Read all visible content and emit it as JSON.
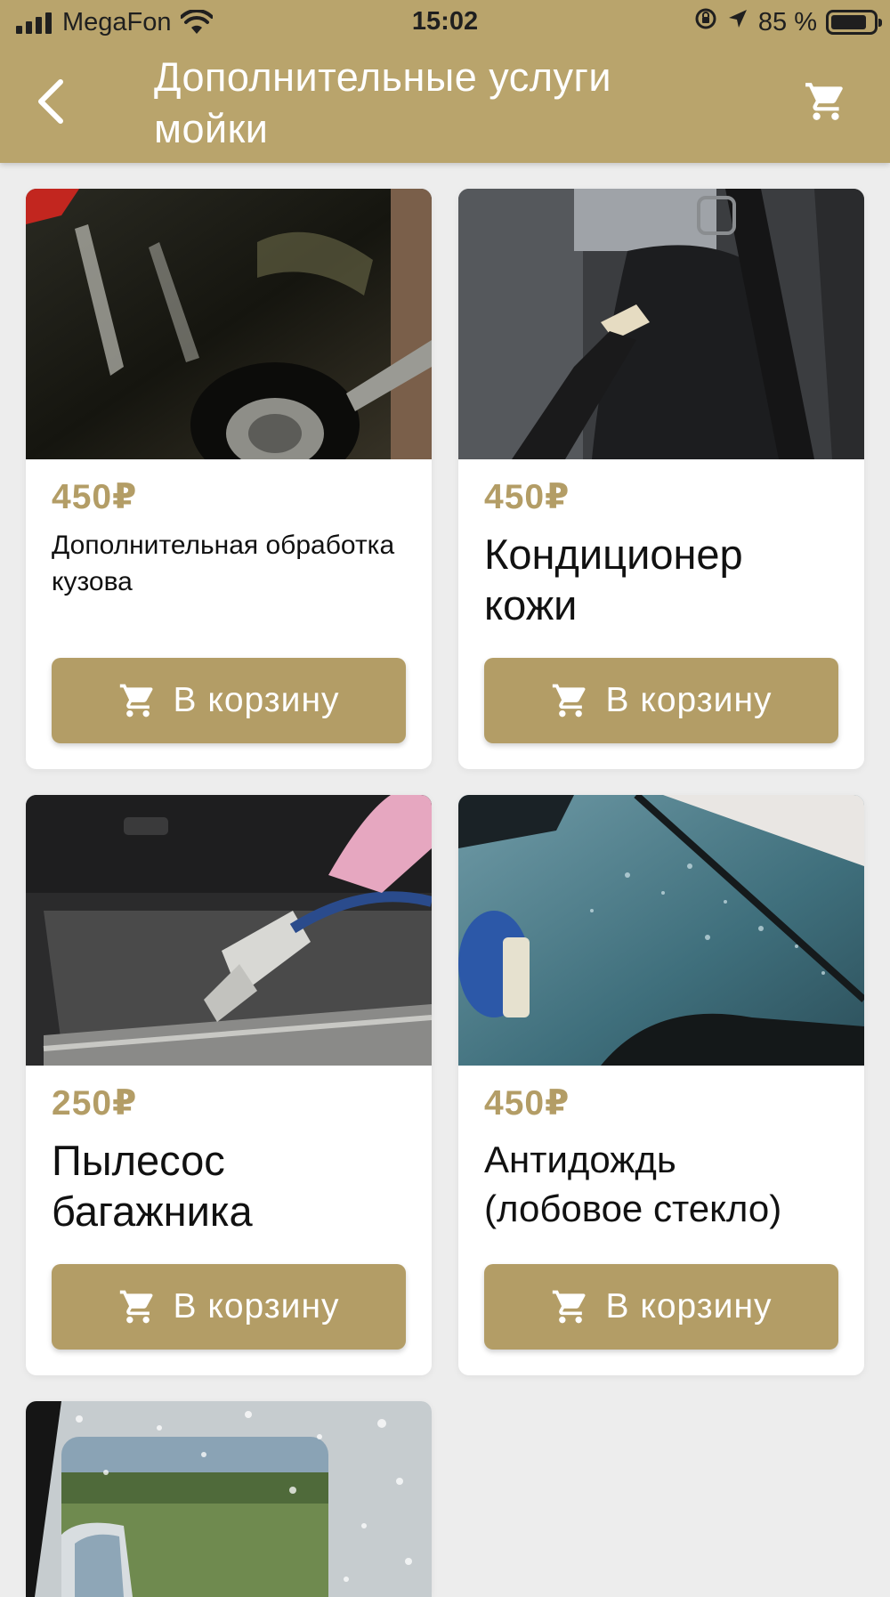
{
  "status_bar": {
    "carrier": "MegaFon",
    "time": "15:02",
    "battery_percent_text": "85 %",
    "battery_level": 0.85
  },
  "header": {
    "title": "Дополнительные услуги мойки"
  },
  "colors": {
    "accent": "#b9a46c",
    "button": "#b39d66",
    "price": "#b39d66",
    "background": "#ededed"
  },
  "products": [
    {
      "price": "450₽",
      "name": "Дополнительная обработка кузова",
      "button_label": "В корзину",
      "image": "car-body-polish"
    },
    {
      "price": "450₽",
      "name": "Кондиционер кожи",
      "button_label": "В корзину",
      "image": "leather-seat-conditioning"
    },
    {
      "price": "250₽",
      "name": "Пылесос багажника",
      "button_label": "В корзину",
      "image": "trunk-vacuum"
    },
    {
      "price": "450₽",
      "name": "Антидождь (лобовое стекло)",
      "button_label": "В корзину",
      "image": "windshield-rain-repellent"
    },
    {
      "image": "mirror-rain-repellent"
    }
  ],
  "icons": {
    "back": "chevron-left-icon",
    "cart": "cart-icon"
  }
}
